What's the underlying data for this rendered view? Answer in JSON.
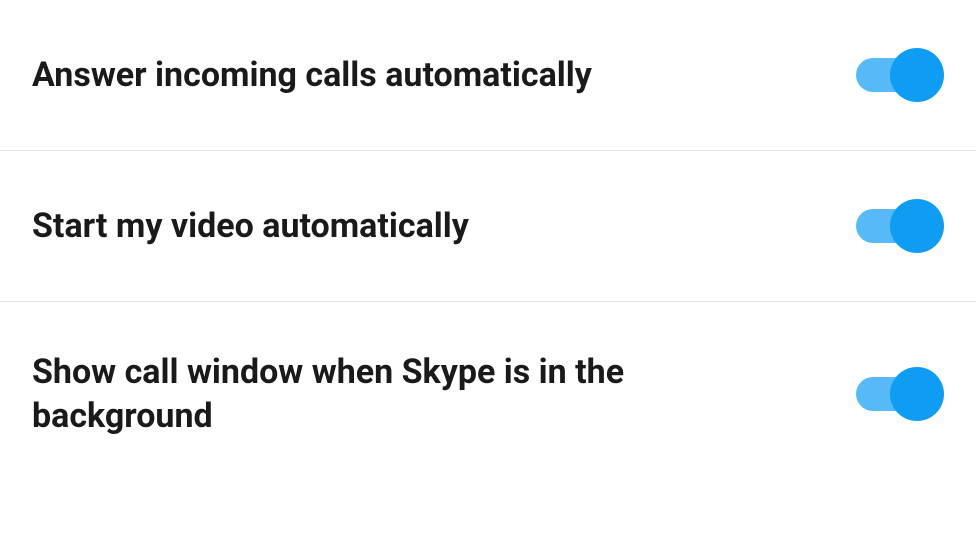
{
  "settings": [
    {
      "label": "Answer incoming calls automatically",
      "enabled": true
    },
    {
      "label": "Start my video automatically",
      "enabled": true
    },
    {
      "label": "Show call window when Skype is in the background",
      "enabled": true
    }
  ],
  "colors": {
    "accent": "#0f9cf3"
  }
}
